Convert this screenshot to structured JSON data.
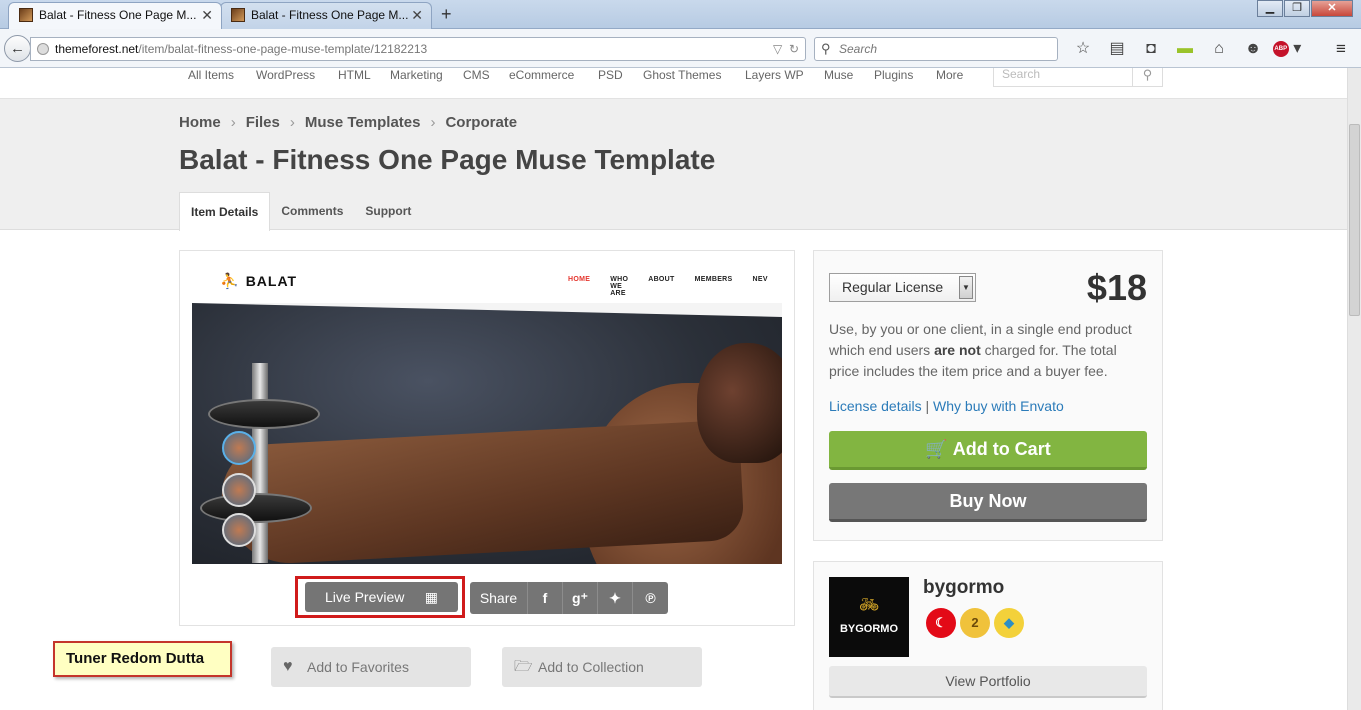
{
  "browser": {
    "tabs": [
      {
        "title": "Balat - Fitness One Page M...",
        "active": true
      },
      {
        "title": "Balat - Fitness One Page M...",
        "active": false
      }
    ],
    "url_host": "themeforest.net",
    "url_path": "/item/balat-fitness-one-page-muse-template/12182213",
    "search_placeholder": "Search"
  },
  "site": {
    "categories": [
      "All Items",
      "WordPress",
      "HTML",
      "Marketing",
      "CMS",
      "eCommerce",
      "PSD",
      "Ghost Themes",
      "Layers WP",
      "Muse",
      "Plugins",
      "More"
    ],
    "search_placeholder": "Search"
  },
  "breadcrumb": [
    "Home",
    "Files",
    "Muse Templates",
    "Corporate"
  ],
  "page_title": "Balat - Fitness One Page Muse Template",
  "tabs": [
    "Item Details",
    "Comments",
    "Support"
  ],
  "preview": {
    "logo": "BALAT",
    "nav": [
      "HOME",
      "WHO WE ARE",
      "ABOUT",
      "MEMBERS",
      "NEV"
    ]
  },
  "actions": {
    "live_preview": "Live Preview",
    "share": "Share",
    "add_favorites": "Add to Favorites",
    "add_collection": "Add to Collection"
  },
  "annotation": "Tuner Redom Dutta",
  "purchase": {
    "license": "Regular License",
    "price": "$18",
    "desc_1": "Use, by you or one client, in a single end product which end users ",
    "desc_bold": "are not",
    "desc_2": " charged for. The total price includes the item price and a buyer fee.",
    "license_details": "License details",
    "why_buy": "Why buy with Envato",
    "add_to_cart": "Add to Cart",
    "buy_now": "Buy Now"
  },
  "author": {
    "name": "bygormo",
    "avatar_text": "BYGORMO",
    "paw_level": "2",
    "view_portfolio": "View Portfolio"
  }
}
